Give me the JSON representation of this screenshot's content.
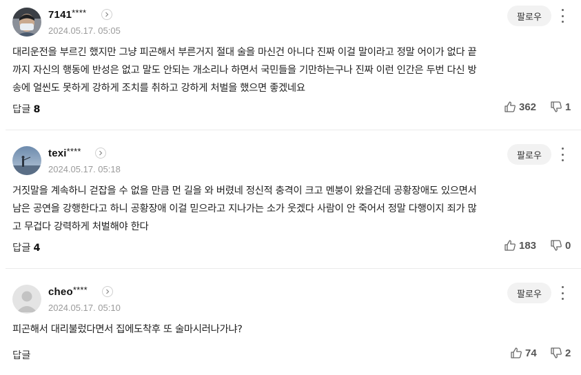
{
  "comments": [
    {
      "username": "7141",
      "mask": "****",
      "timestamp": "2024.05.17. 05:05",
      "follow_label": "팔로우",
      "lines": [
        "대리운전을 부르긴 했지만 그냥 피곤해서 부른거지 절대 술을 마신건 아니다 진짜 이걸 말이라고 정말 어이가 없다 끝",
        "까지 자신의 행동에 반성은 없고 말도 안되는 개소리나 하면서 국민들을 기만하는구나 진짜 이런 인간은 두번 다신 방",
        "송에 얼씬도 못하게 강하게 조치를 취하고 강하게 처벌을 했으면 좋겠네요"
      ],
      "reply_label": "답글",
      "reply_count": "8",
      "likes": "362",
      "dislikes": "1"
    },
    {
      "username": "texi",
      "mask": "****",
      "timestamp": "2024.05.17. 05:18",
      "follow_label": "팔로우",
      "lines": [
        "거짓말을 계속하니 걷잡을 수 없을 만큼 먼 길을 와 버렸네 정신적 충격이 크고 멘붕이 왔을건데 공황장애도 있으면서",
        "남은 공연을 강행한다고 하니 공황장애 이걸 믿으라고 지나가는 소가 웃겠다 사람이 안 죽어서 정말 다행이지 죄가 많",
        "고 무겁다 강력하게 처벌해야 한다"
      ],
      "reply_label": "답글",
      "reply_count": "4",
      "likes": "183",
      "dislikes": "0"
    },
    {
      "username": "cheo",
      "mask": "****",
      "timestamp": "2024.05.17. 05:10",
      "follow_label": "팔로우",
      "lines": [
        "피곤해서 대리불렀다면서 집에도착후 또 술마시러나가냐?"
      ],
      "reply_label": "답글",
      "reply_count": "",
      "likes": "74",
      "dislikes": "2"
    }
  ],
  "icons": {
    "like": "thumbs-up-icon",
    "dislike": "thumbs-down-icon",
    "profile": "chevron-right-icon",
    "more": "more-vertical-icon"
  },
  "colors": {
    "meta": "#9a9a9a",
    "follow_bg": "#f2f2f2",
    "separator": "#ebebeb"
  }
}
